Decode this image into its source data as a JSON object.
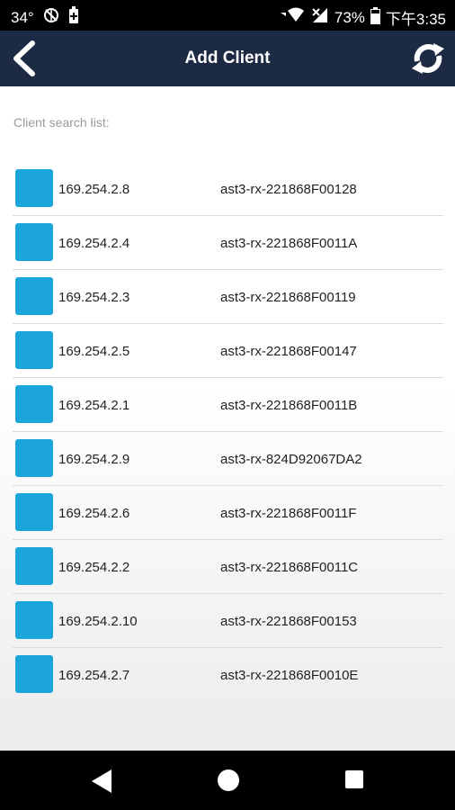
{
  "status_bar": {
    "temperature": "34°",
    "battery_percent": "73%",
    "time": "下午3:35",
    "icons": [
      "no-location-icon",
      "battery-plus-icon",
      "wifi-icon",
      "signal-icon",
      "battery-icon"
    ]
  },
  "app_bar": {
    "title": "Add Client",
    "back_icon": "chevron-left-icon",
    "refresh_icon": "refresh-icon",
    "background": "#1d2a44"
  },
  "search": {
    "label": "Client search list:"
  },
  "clients": [
    {
      "ip": "169.254.2.8",
      "host": "ast3-rx-221868F00128"
    },
    {
      "ip": "169.254.2.4",
      "host": "ast3-rx-221868F0011A"
    },
    {
      "ip": "169.254.2.3",
      "host": "ast3-rx-221868F00119"
    },
    {
      "ip": "169.254.2.5",
      "host": "ast3-rx-221868F00147"
    },
    {
      "ip": "169.254.2.1",
      "host": "ast3-rx-221868F0011B"
    },
    {
      "ip": "169.254.2.9",
      "host": "ast3-rx-824D92067DA2"
    },
    {
      "ip": "169.254.2.6",
      "host": "ast3-rx-221868F0011F"
    },
    {
      "ip": "169.254.2.2",
      "host": "ast3-rx-221868F0011C"
    },
    {
      "ip": "169.254.2.10",
      "host": "ast3-rx-221868F00153"
    },
    {
      "ip": "169.254.2.7",
      "host": "ast3-rx-221868F0010E"
    }
  ],
  "colors": {
    "thumbnail": "#1ba5da",
    "app_bar": "#1d2a44"
  },
  "nav_bar": {
    "icons": [
      "back-triangle-icon",
      "home-circle-icon",
      "recents-square-icon"
    ]
  }
}
